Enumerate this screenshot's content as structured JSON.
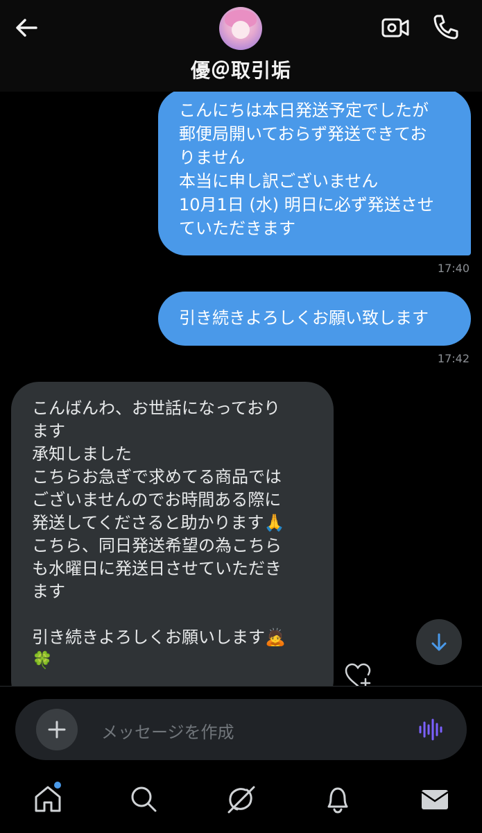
{
  "header": {
    "contact_name": "優＠取引垢",
    "icons": {
      "back": "arrow-left-icon",
      "video": "video-call-icon",
      "phone": "phone-icon"
    }
  },
  "messages": [
    {
      "direction": "outgoing",
      "text": "こんにちは本日発送予定でしたが\n郵便局開いておらず発送できてお\nりません\n本当に申し訳ございません\n10月1日 (水) 明日に必ず発送させ\nていただきます",
      "time": "17:40"
    },
    {
      "direction": "outgoing",
      "text": "引き続きよろしくお願い致します",
      "time": "17:42"
    },
    {
      "direction": "incoming",
      "text": "こんばんわ、お世話になっており\nます\n承知しました\nこちらお急ぎで求めてる商品では\nございませんのでお時間ある際に\n発送してくださると助かります🙏\nこちら、同日発送希望の為こちら\nも水曜日に発送日させていただき\nます\n\n引き続きよろしくお願いします🙇\n🍀"
    }
  ],
  "composer": {
    "placeholder": "メッセージを作成",
    "icons": {
      "add": "plus-icon",
      "voice": "audio-wave-icon"
    }
  },
  "scroll_button_icon": "arrow-down-icon",
  "reaction_icon": "heart-plus-icon",
  "tabbar": {
    "items": [
      "home-icon",
      "search-icon",
      "grok-icon",
      "bell-icon",
      "mail-icon"
    ],
    "notification_dot_on": "home"
  },
  "colors": {
    "outgoing_bubble": "#4a99e9",
    "incoming_bubble": "#2f3336",
    "accent": "#4a99e9",
    "voice_icon": "#7b61ff"
  }
}
